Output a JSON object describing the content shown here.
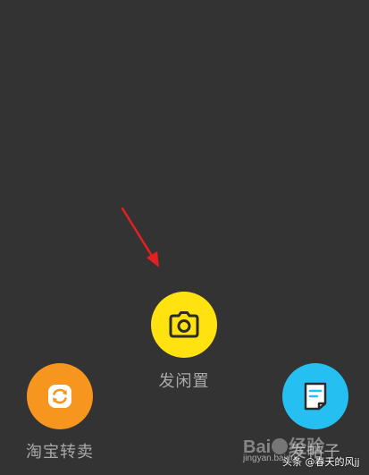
{
  "colors": {
    "background": "#333333",
    "idle_button": "#ffe20f",
    "resell_button": "#f7961f",
    "post_button": "#25bff2",
    "label_text": "#a9a9a9",
    "arrow": "#e32020"
  },
  "actions": {
    "idle": {
      "label": "发闲置",
      "icon": "camera-icon"
    },
    "resell": {
      "label": "淘宝转卖",
      "icon": "swap-icon"
    },
    "post": {
      "label": "发帖子",
      "icon": "note-icon"
    }
  },
  "annotation": {
    "icon": "red-arrow"
  },
  "watermarks": {
    "baidu_left": "Bai",
    "baidu_right": "经验",
    "jingyan": "jingyan.baidu",
    "toutiao": "头条 @春天的风jj"
  }
}
